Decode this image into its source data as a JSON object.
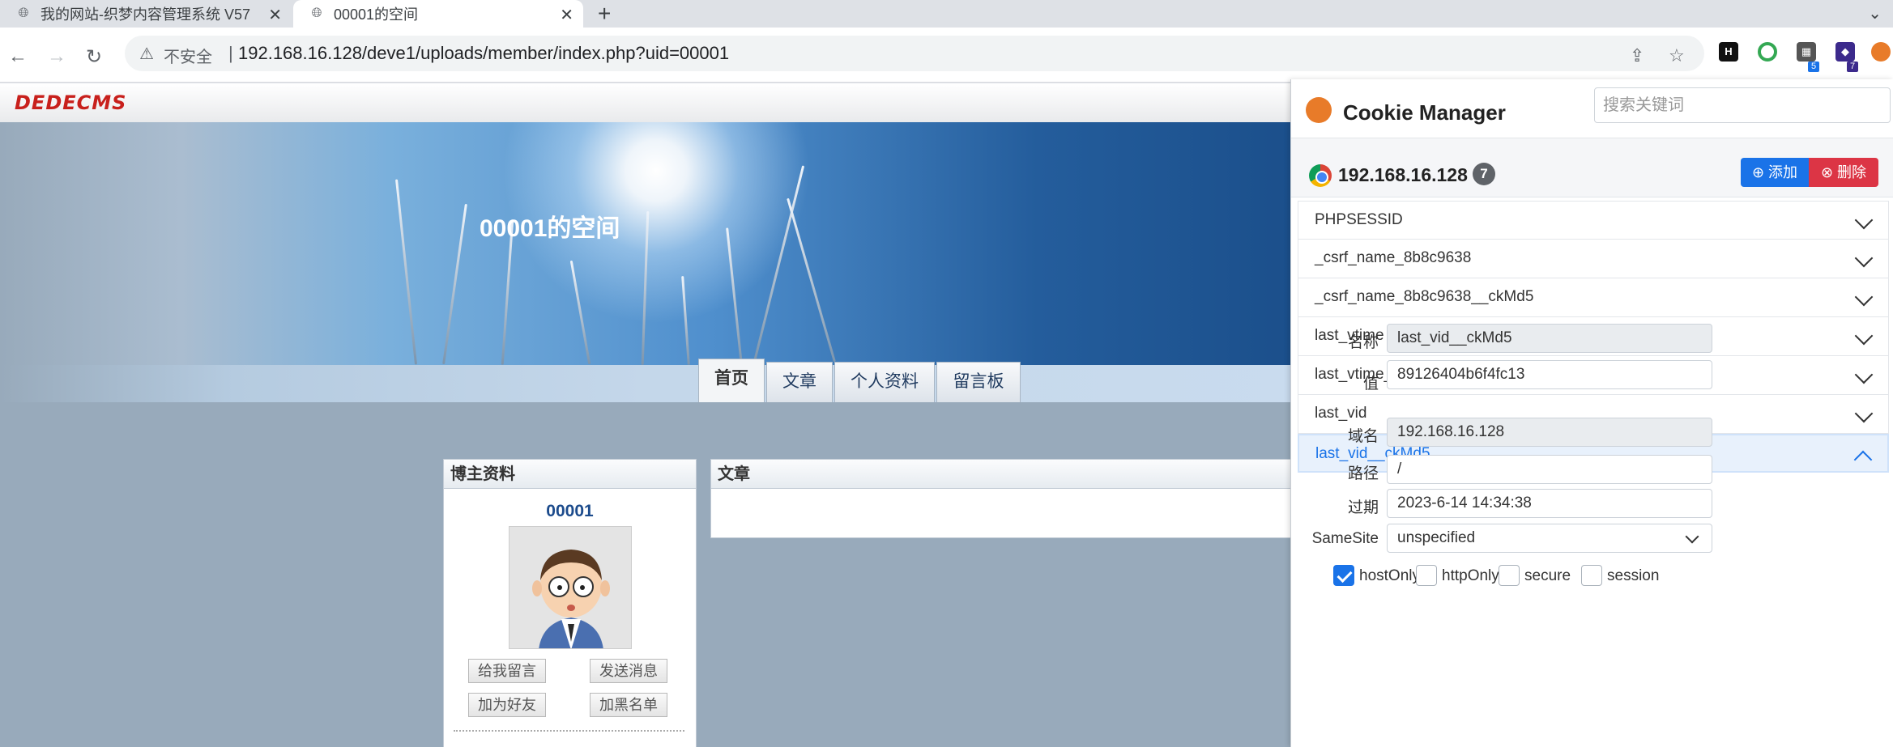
{
  "browser": {
    "tabs": [
      {
        "title": "我的网站-织梦内容管理系统 V57",
        "active": false
      },
      {
        "title": "00001的空间",
        "active": true
      }
    ],
    "url_warning": "不安全",
    "url_separator": "|",
    "url": "192.168.16.128/deve1/uploads/member/index.php?uid=00001",
    "new_tab": "+",
    "extensions": [
      {
        "name": "H",
        "color": "#111111"
      },
      {
        "name": "O",
        "color": "#34a853"
      },
      {
        "name": "qr",
        "badge": "5",
        "color": "#444444"
      },
      {
        "name": "cap",
        "badge": "7",
        "color": "#3c2a8c"
      },
      {
        "name": "cookie",
        "color": "#e87b29"
      }
    ]
  },
  "site": {
    "logo": "DEDECMS",
    "space_title": "00001的空间",
    "nav_tabs": [
      {
        "label": "首页",
        "active": true
      },
      {
        "label": "文章",
        "active": false
      },
      {
        "label": "个人资料",
        "active": false
      },
      {
        "label": "留言板",
        "active": false
      }
    ],
    "profile_panel": {
      "title": "博主资料",
      "username": "00001",
      "buttons": [
        "给我留言",
        "发送消息",
        "加为好友",
        "加黑名单"
      ]
    },
    "article_panel": {
      "title": "文章"
    }
  },
  "cookie_manager": {
    "title": "Cookie Manager",
    "search_placeholder": "搜索关键词",
    "domain": "192.168.16.128",
    "count": "7",
    "add_label": "添加",
    "delete_label": "删除",
    "cookies": [
      {
        "name": "PHPSESSID",
        "open": false
      },
      {
        "name": "_csrf_name_8b8c9638",
        "open": false
      },
      {
        "name": "_csrf_name_8b8c9638__ckMd5",
        "open": false
      },
      {
        "name": "last_vtime",
        "open": false
      },
      {
        "name": "last_vtime__ckMd5",
        "open": false
      },
      {
        "name": "last_vid",
        "open": false
      },
      {
        "name": "last_vid__ckMd5",
        "open": true
      }
    ],
    "detail": {
      "name_label": "名称",
      "name": "last_vid__ckMd5",
      "value_label": "值",
      "value": "89126404b6f4fc13",
      "domain_label": "域名",
      "domain": "192.168.16.128",
      "path_label": "路径",
      "path": "/",
      "expires_label": "过期",
      "expires": "2023-6-14 14:34:38",
      "samesite_label": "SameSite",
      "samesite": "unspecified",
      "flags": [
        {
          "label": "hostOnly",
          "checked": true
        },
        {
          "label": "httpOnly",
          "checked": false
        },
        {
          "label": "secure",
          "checked": false
        },
        {
          "label": "session",
          "checked": false
        }
      ]
    }
  }
}
